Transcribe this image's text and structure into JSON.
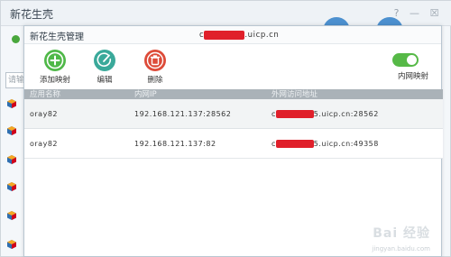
{
  "app": {
    "window_title": "新花生壳"
  },
  "background": {
    "search_placeholder": "请输",
    "window_controls": [
      "?",
      "—",
      "☒"
    ]
  },
  "dialog": {
    "title": "新花生壳管理",
    "domain_prefix": "c",
    "domain_redacted": "xxxxxxxx",
    "domain_suffix": ".uicp.cn"
  },
  "toolbar": {
    "add_label": "添加映射",
    "edit_label": "编辑",
    "delete_label": "删除",
    "lan_mapping_label": "内网映射",
    "lan_mapping_on": true
  },
  "table": {
    "headers": [
      "应用名称",
      "内网IP",
      "外网访问地址"
    ],
    "rows": [
      {
        "app": "oray82",
        "lan": "192.168.121.137:28562",
        "wan_prefix": "c",
        "wan_redacted": "xxxxxxxx",
        "wan_suffix": "5.uicp.cn:28562"
      },
      {
        "app": "oray82",
        "lan": "192.168.121.137:82",
        "wan_prefix": "c",
        "wan_redacted": "xxxxxxxx",
        "wan_suffix": "5.uicp.cn:49358"
      }
    ]
  },
  "watermark": {
    "text": "Bai 经验",
    "url": "jingyan.baidu.com"
  },
  "colors": {
    "accent_green": "#4fb848",
    "edit_teal": "#3aa99a",
    "delete_red": "#dd4b39",
    "redaction": "#e0202b"
  }
}
